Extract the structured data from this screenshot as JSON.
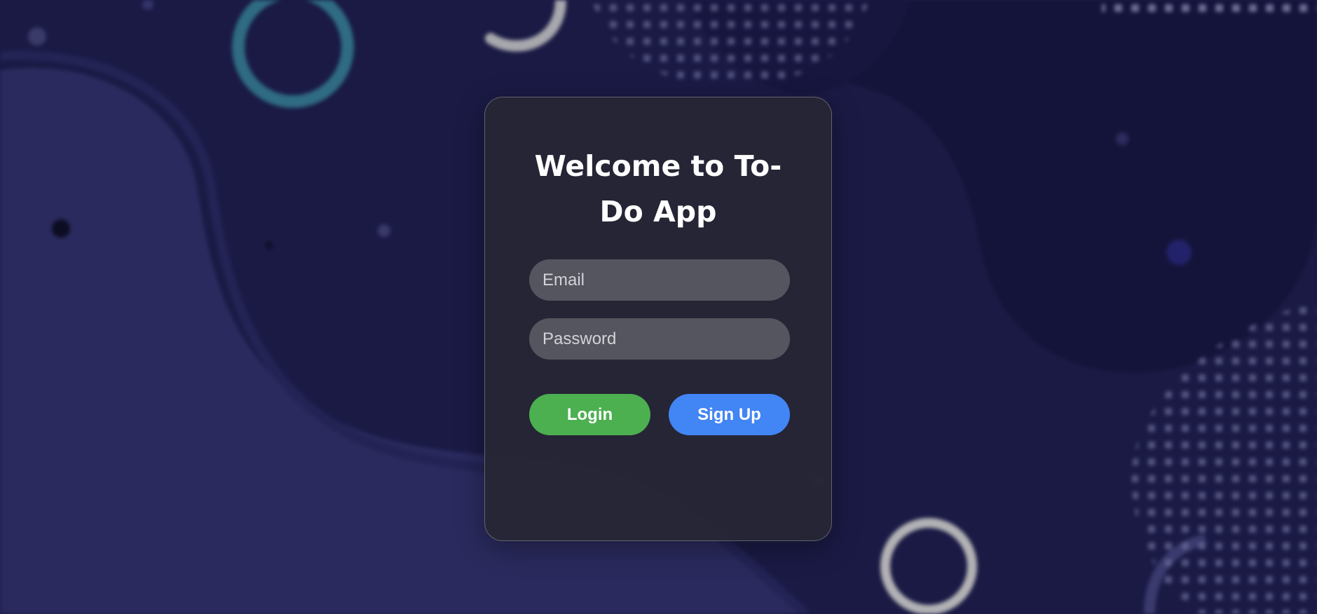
{
  "colors": {
    "background": "#1a1a45",
    "card": "#262634",
    "input": "#55555f",
    "login_button": "#4caf50",
    "signup_button": "#4285f4"
  },
  "login_card": {
    "title": "Welcome to To-Do App",
    "email": {
      "placeholder": "Email",
      "value": ""
    },
    "password": {
      "placeholder": "Password",
      "value": ""
    },
    "login_label": "Login",
    "signup_label": "Sign Up"
  }
}
